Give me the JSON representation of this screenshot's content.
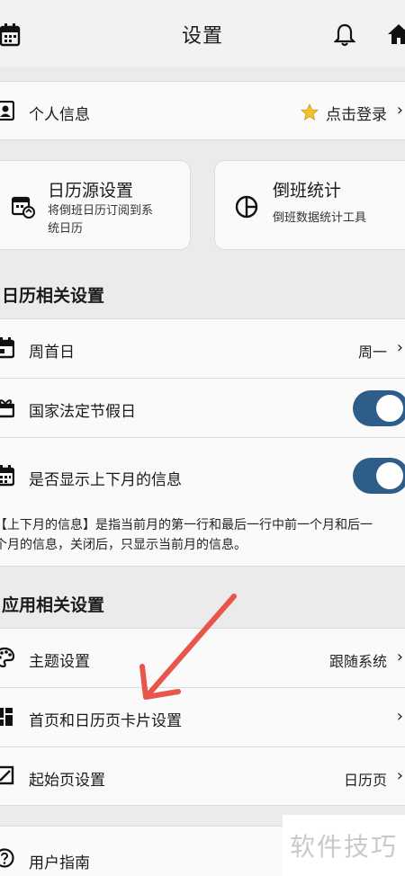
{
  "header": {
    "title": "设置"
  },
  "personal": {
    "label": "个人信息",
    "login": "点击登录"
  },
  "cards": [
    {
      "title": "日历源设置",
      "subtitle_line1": "将倒班日历订阅到系",
      "subtitle_line2": "统日历"
    },
    {
      "title": "倒班统计",
      "subtitle_line1": "倒班数据统计工具"
    }
  ],
  "calendar_section": {
    "heading": "日历相关设置",
    "week_start": {
      "label": "周首日",
      "value": "周一"
    },
    "holidays": {
      "label": "国家法定节假日",
      "enabled": true
    },
    "adjacent_month": {
      "label": "是否显示上下月的信息",
      "enabled": true
    },
    "note_line1": "【上下月的信息】是指当前月的第一行和最后一行中前一个月和后一",
    "note_line2": "个月的信息，关闭后，只显示当前月的信息。"
  },
  "app_section": {
    "heading": "应用相关设置",
    "theme": {
      "label": "主题设置",
      "value": "跟随系统"
    },
    "cards_setting": {
      "label": "首页和日历页卡片设置"
    },
    "start_page": {
      "label": "起始页设置",
      "value": "日历页"
    }
  },
  "guide": {
    "label": "用户指南"
  },
  "watermark": "软件技巧",
  "colors": {
    "toggle_on": "#2e5d8a",
    "arrow": "#e8554a",
    "star": "#f2c230"
  }
}
